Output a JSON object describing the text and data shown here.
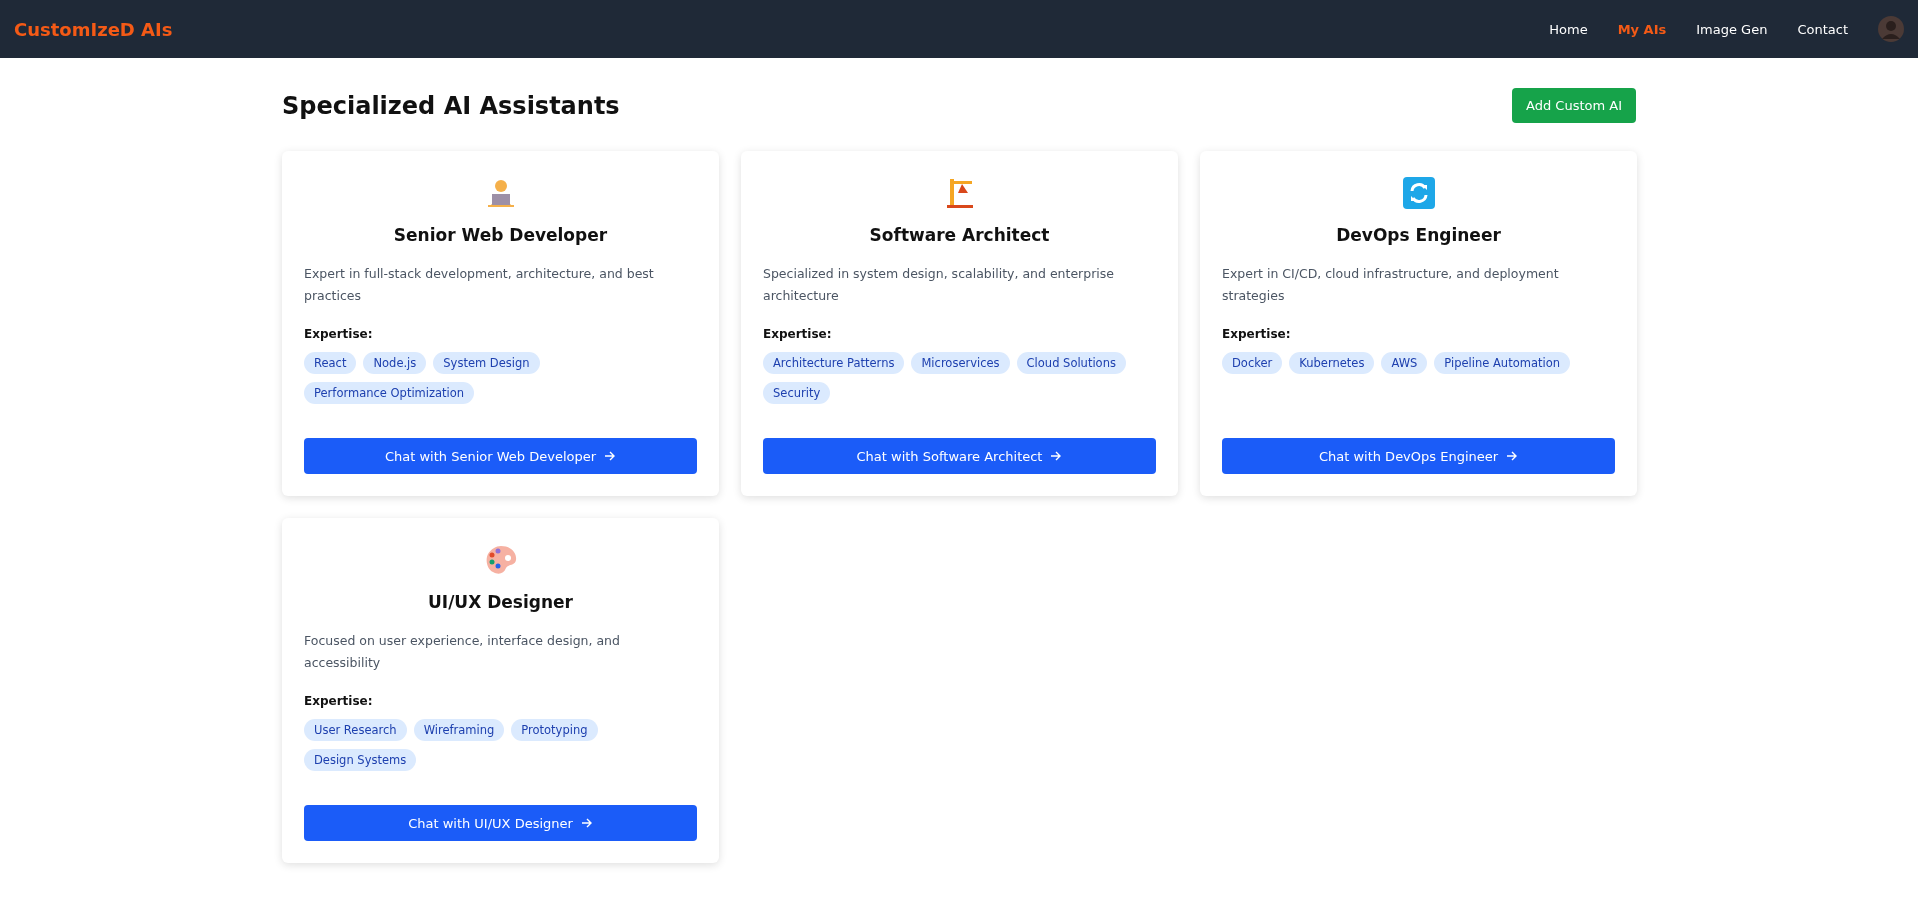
{
  "navbar": {
    "brand": "CustomIzeD AIs",
    "links": [
      {
        "label": "Home",
        "selected": false
      },
      {
        "label": "My AIs",
        "selected": true
      },
      {
        "label": "Image Gen",
        "selected": false
      },
      {
        "label": "Contact",
        "selected": false
      }
    ]
  },
  "page": {
    "title": "Specialized AI Assistants",
    "add_button": "Add Custom AI"
  },
  "cards": [
    {
      "kind": "developer",
      "title": "Senior Web Developer",
      "description": "Expert in full-stack development, architecture, and best practices",
      "expertise_label": "Expertise:",
      "tags": [
        "React",
        "Node.js",
        "System Design",
        "Performance Optimization"
      ],
      "button": "Chat with Senior Web Developer"
    },
    {
      "kind": "crane",
      "title": "Software Architect",
      "description": "Specialized in system design, scalability, and enterprise architecture",
      "expertise_label": "Expertise:",
      "tags": [
        "Architecture Patterns",
        "Microservices",
        "Cloud Solutions",
        "Security"
      ],
      "button": "Chat with Software Architect"
    },
    {
      "kind": "cycle",
      "title": "DevOps Engineer",
      "description": "Expert in CI/CD, cloud infrastructure, and deployment strategies",
      "expertise_label": "Expertise:",
      "tags": [
        "Docker",
        "Kubernetes",
        "AWS",
        "Pipeline Automation"
      ],
      "button": "Chat with DevOps Engineer"
    },
    {
      "kind": "palette",
      "title": "UI/UX Designer",
      "description": "Focused on user experience, interface design, and accessibility",
      "expertise_label": "Expertise:",
      "tags": [
        "User Research",
        "Wireframing",
        "Prototyping",
        "Design Systems"
      ],
      "button": "Chat with UI/UX Designer"
    }
  ]
}
